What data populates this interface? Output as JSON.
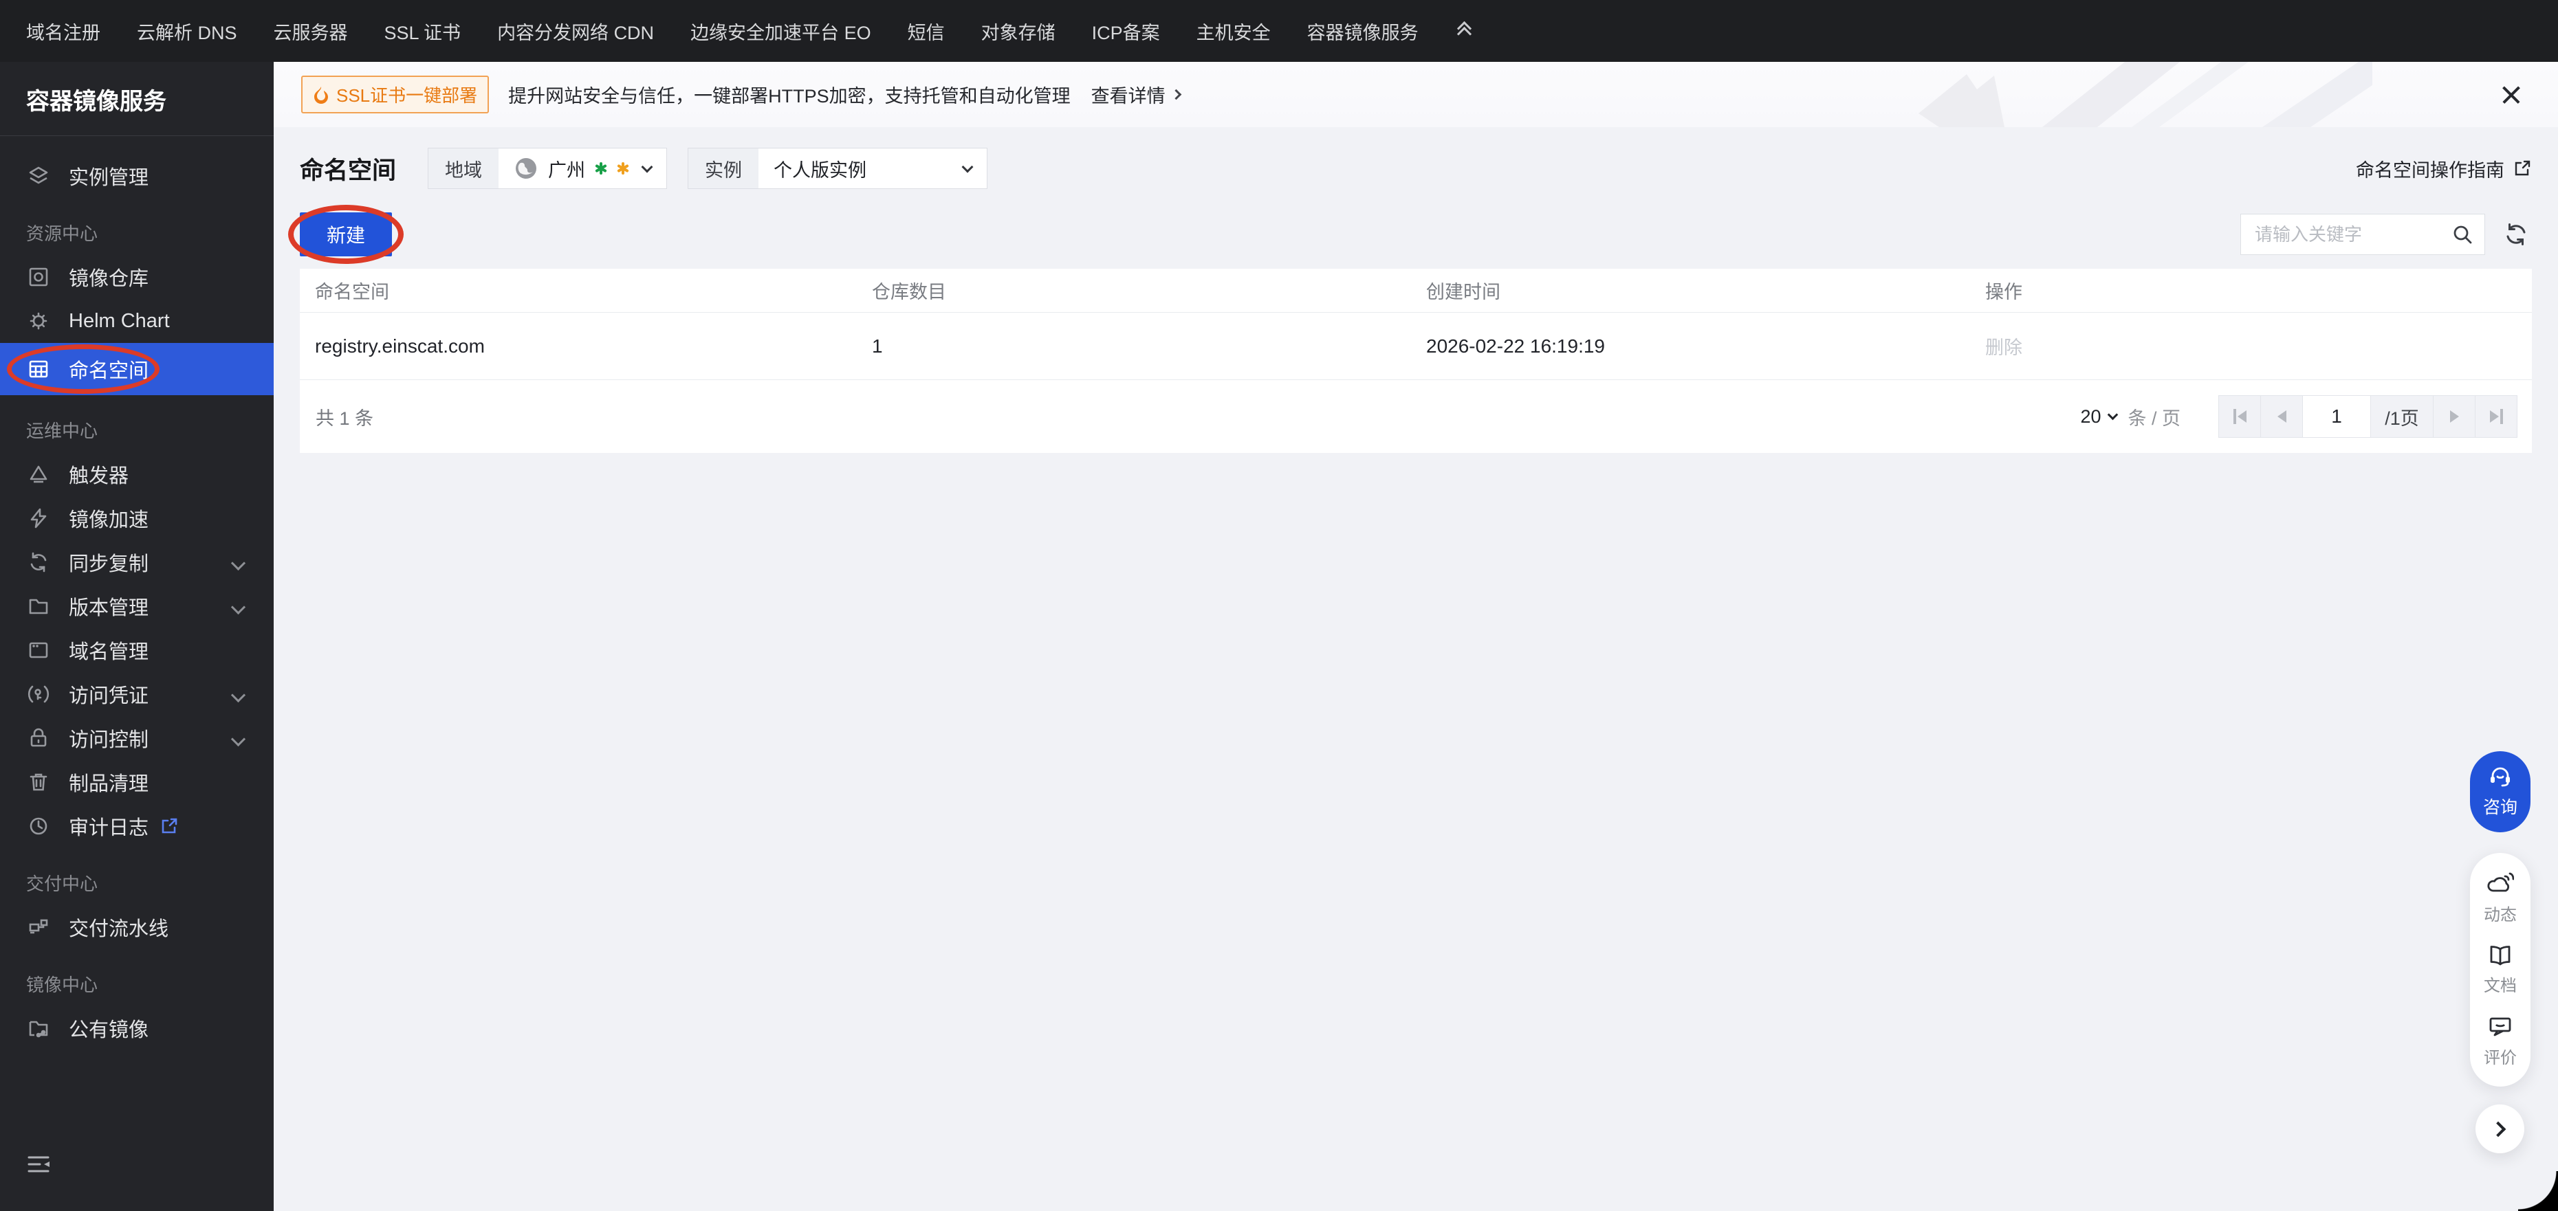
{
  "topnav": {
    "items": [
      "域名注册",
      "云解析 DNS",
      "云服务器",
      "SSL 证书",
      "内容分发网络 CDN",
      "边缘安全加速平台 EO",
      "短信",
      "对象存储",
      "ICP备案",
      "主机安全",
      "容器镜像服务"
    ]
  },
  "sidebar": {
    "title": "容器镜像服务",
    "items": {
      "instance_mgmt": "实例管理",
      "repo": "镜像仓库",
      "helm": "Helm Chart",
      "namespace": "命名空间",
      "trigger": "触发器",
      "accel": "镜像加速",
      "sync": "同步复制",
      "version": "版本管理",
      "domain": "域名管理",
      "credential": "访问凭证",
      "access": "访问控制",
      "cleanup": "制品清理",
      "audit": "审计日志",
      "pipeline": "交付流水线",
      "public_image": "公有镜像"
    },
    "sections": {
      "resource": "资源中心",
      "ops": "运维中心",
      "delivery": "交付中心",
      "image": "镜像中心"
    }
  },
  "banner": {
    "badge": "SSL证书一键部署",
    "text": "提升网站安全与信任，一键部署HTTPS加密，支持托管和自动化管理",
    "link": "查看详情"
  },
  "page": {
    "title": "命名空间",
    "region_label": "地域",
    "region_value": "广州",
    "instance_label": "实例",
    "instance_value": "个人版实例",
    "guide_link": "命名空间操作指南"
  },
  "toolbar": {
    "create_label": "新建",
    "search_placeholder": "请输入关键字"
  },
  "table": {
    "headers": [
      "命名空间",
      "仓库数目",
      "创建时间",
      "操作"
    ],
    "rows": [
      {
        "namespace": "registry.einscat.com",
        "repo_count": "1",
        "created_at": "2026-02-22 16:19:19",
        "action": "删除"
      }
    ],
    "total": "共 1 条"
  },
  "pagination": {
    "page_size": "20",
    "per_page_label": "条 / 页",
    "current_page": "1",
    "pages_label": "/1页"
  },
  "floating": {
    "consult": "咨询",
    "news": "动态",
    "docs": "文档",
    "feedback": "评价"
  },
  "colors": {
    "primary_blue": "#2253d9",
    "sidebar_active_blue": "#2e5ada",
    "annotation_red": "#dc3b28",
    "badge_orange": "#e87a12"
  }
}
